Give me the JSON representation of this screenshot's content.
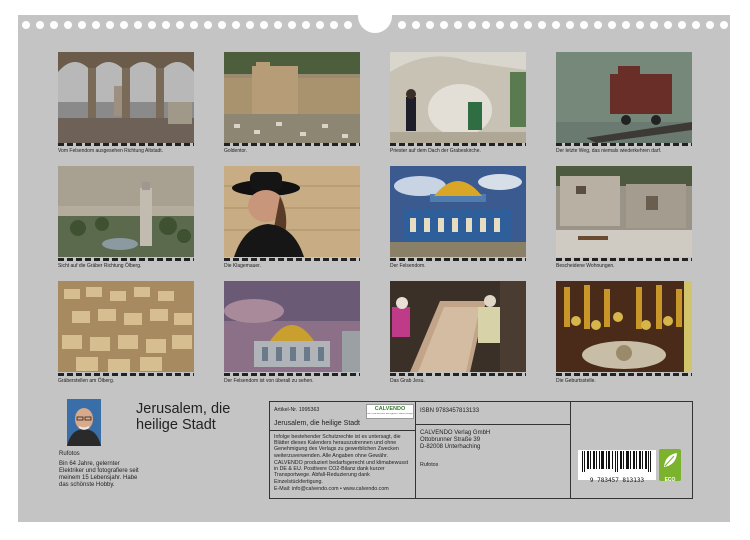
{
  "captions": [
    "Vom Felsendom ausgesehen Richtung Altstadt.",
    "Goldentor.",
    "Priester auf dem Dach der Grabeskirche.",
    "Der letzte Weg, das niemals wiederkehren darf.",
    "Sicht auf die Gräber Richtung Ölberg.",
    "Die Klagemauer.",
    "Der Felsendom.",
    "Bescheidene Wohnungen.",
    "Gräberstellen am Ölberg.",
    "Der Felsendom ist von überall zu sehen.",
    "Das Grab Jesu.",
    "Die Geburtsstelle."
  ],
  "title_line1": "Jerusalem, die",
  "title_line2": "heilige Stadt",
  "author": "Rufotos",
  "bio": "Bin 64 Jahre, gelernter Elektriker und fotografiere seit meinem 15 Lebensjahr. Habe das schönste Hobby.",
  "info": {
    "article_no": "Artikel-Nr. 1995363",
    "calvendo_logo": "CALVENDO",
    "calvendo_sub": "Ein Unternehmen der Agentur Veerle Design",
    "calendar_title": "Jerusalem, die heilige Stadt",
    "legal1": "Infolge bestehender Schutzrechte ist es untersagt, die Blätter dieses Kalenders herauszutrennen und ohne Genehmigung des Verlags zu gewerblichen Zwecken weiterzuverwenden. Alle Angaben ohne Gewähr.",
    "legal2": "CALVENDO produziert bedarfsgerecht und klimabewusst in DE & EU. Positivere CO2-Bilanz dank kurzer Transportwege. Abfall-Reduzierung dank Einzelstückfertigung.",
    "email": "E-Mail: info@calvendo.com • www.calvendo.com",
    "isbn": "ISBN 9783457813133",
    "publisher1": "CALVENDO Verlag GmbH",
    "publisher2": "Ottobrunner Straße 39",
    "publisher3": "D-82008 Unterhaching",
    "photographer": "Rufotos",
    "barcode_digits": "9 783457 813133",
    "eco_label": "ECO"
  }
}
